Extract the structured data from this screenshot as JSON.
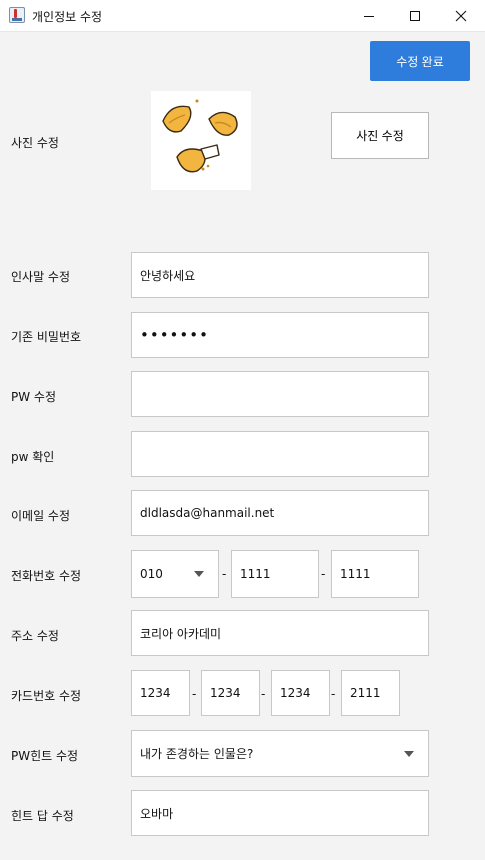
{
  "window": {
    "title": "개인정보 수정"
  },
  "header": {
    "done_label": "수정 완료"
  },
  "photo": {
    "label": "사진 수정",
    "button_label": "사진 수정",
    "image_icon": "fortune-cookies"
  },
  "fields": {
    "greeting": {
      "label": "인사말 수정",
      "value": "안녕하세요"
    },
    "current_pw": {
      "label": "기존 비밀번호",
      "value": "•••••••"
    },
    "new_pw": {
      "label": "PW 수정",
      "value": ""
    },
    "pw_confirm": {
      "label": "pw 확인",
      "value": ""
    },
    "email": {
      "label": "이메일 수정",
      "value": "dldlasda@hanmail.net"
    },
    "phone": {
      "label": "전화번호 수정",
      "prefix": "010",
      "middle": "1111",
      "last": "1111",
      "sep": "-"
    },
    "address": {
      "label": "주소 수정",
      "value": "코리아 아카데미"
    },
    "card": {
      "label": "카드번호 수정",
      "p1": "1234",
      "p2": "1234",
      "p3": "1234",
      "p4": "2111",
      "sep": "-"
    },
    "pw_hint": {
      "label": "PW힌트 수정",
      "value": "내가 존경하는 인물은?"
    },
    "hint_answer": {
      "label": "힌트 답 수정",
      "value": "오바마"
    }
  }
}
